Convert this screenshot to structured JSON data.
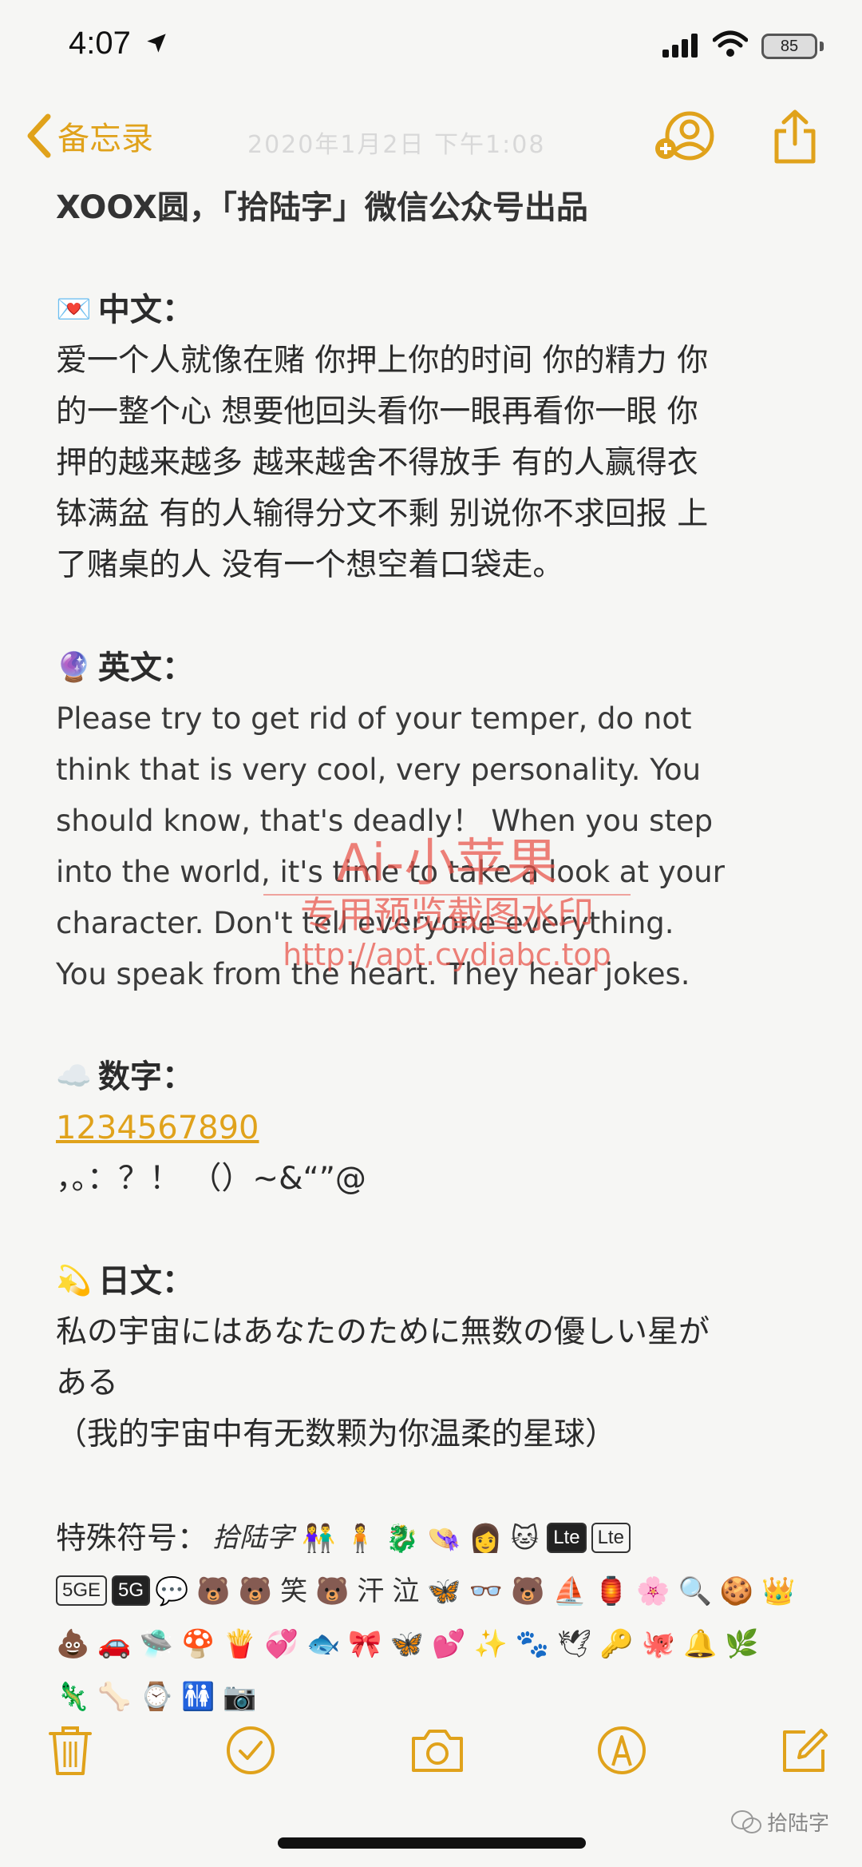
{
  "status": {
    "time": "4:07",
    "battery": "85"
  },
  "nav": {
    "back_label": "备忘录",
    "ghost_date": "2020年1月2日 下午1:08"
  },
  "note": {
    "title": "XOOX圆，「拾陆字」微信公众号出品",
    "chinese": {
      "heading": "中文：",
      "emoji": "💌",
      "lines": [
        "爱一个人就像在赌 你押上你的时间 你的精力 你",
        "的一整个心 想要他回头看你一眼再看你一眼 你",
        "押的越来越多 越来越舍不得放手 有的人赢得衣",
        "钵满盆 有的人输得分文不剩 别说你不求回报 上",
        "了赌桌的人 没有一个想空着口袋走。"
      ]
    },
    "english": {
      "heading": "英文：",
      "emoji": "🔮",
      "lines": [
        "Please try to get rid of your temper, do not",
        "think that is very cool, very personality. You",
        "should know, that's deadly！ When you step",
        "into the world, it's time to take a look at your",
        "character. Don't tell everyone everything.",
        "You speak from the heart. They hear jokes."
      ]
    },
    "numbers": {
      "heading": "数字：",
      "emoji": "☁️",
      "digits": "1234567890",
      "punct": "，。：？！ （）~&“”@"
    },
    "japanese": {
      "heading": "日文：",
      "emoji": "💫",
      "lines": [
        "私の宇宙にはあなたのために無数の優しい星が",
        "ある",
        "（我的宇宙中有无数颗为你温柔的星球）"
      ]
    },
    "special": {
      "heading": "特殊符号：",
      "row1_sig": "拾陆字",
      "row1_tags": [
        "Lte",
        "Lte"
      ],
      "row2_tags": [
        "5GE",
        "5G"
      ],
      "row2_syms": [
        "💬",
        "🐻",
        "🐻",
        "笑",
        "🐻",
        "汗",
        "泣",
        "🦋",
        "👓",
        "🐻",
        "⛵",
        "🏮",
        "🌸",
        "🔍",
        "🍪",
        "👑"
      ],
      "row3_syms": [
        "💩",
        "🚗",
        "🛸",
        "🍄",
        "🍟",
        "💞",
        "🐟",
        "🎀",
        "🦋",
        "💕",
        "✨",
        "🐾",
        "🕊",
        "🔑",
        "🐙",
        "🔔",
        "🌿"
      ],
      "row4_syms": [
        "🦎",
        "🦴",
        "⌚",
        "🚻",
        "📷"
      ],
      "row1_syms": [
        "👫",
        "🧍",
        "🐉",
        "👒",
        "👩",
        "🐱"
      ]
    }
  },
  "watermark": {
    "line1": "Ai-小苹果",
    "line2": "专用预览截图水印",
    "line3": "http://apt.cydiabc.top"
  },
  "footer": {
    "wechat_label": "拾陆字"
  },
  "colors": {
    "accent": "#e0a21b",
    "background": "#f6f6f4",
    "watermark": "#e85046"
  }
}
